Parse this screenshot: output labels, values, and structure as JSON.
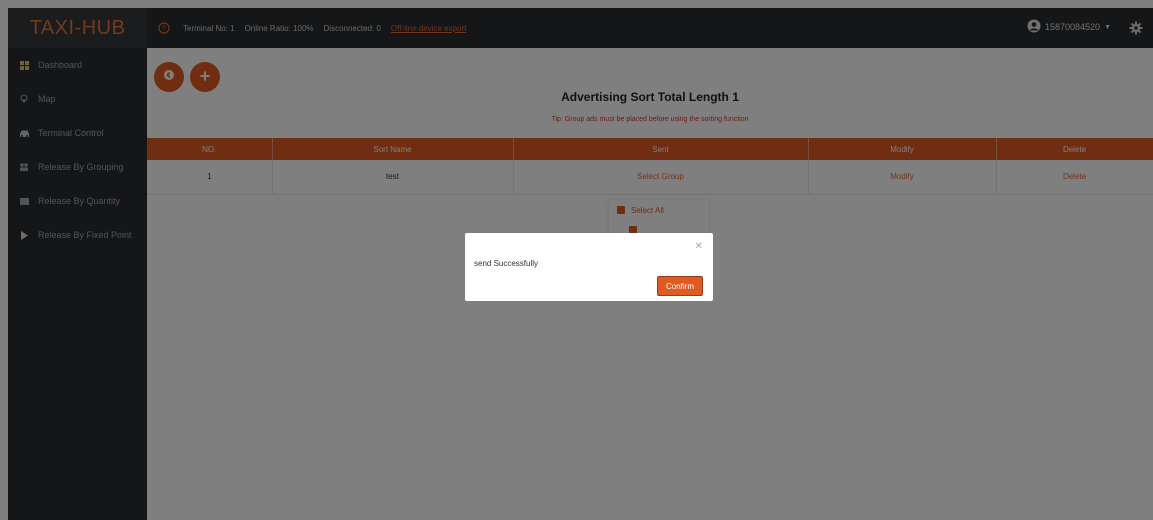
{
  "colors": {
    "accent": "#e05a23",
    "header_bg": "#2a2d30",
    "tip_text": "#e0331c"
  },
  "header": {
    "brand": "TAXI-HUB",
    "stats": {
      "terminal_no": "Terminal No:  1",
      "online_ratio": "Online Ratio:  100%",
      "disconnected": "Disconnected:  0",
      "export_link": "Off-line device export"
    },
    "user": {
      "phone": "15870084520",
      "icon": "user-circle-icon"
    },
    "settings_icon": "gear-icon"
  },
  "sidebar": {
    "items": [
      {
        "label": "Dashboard",
        "icon": "dashboard-icon"
      },
      {
        "label": "Map",
        "icon": "map-pin-icon"
      },
      {
        "label": "Terminal Control",
        "icon": "car-icon"
      },
      {
        "label": "Release By Grouping",
        "icon": "group-icon"
      },
      {
        "label": "Release By Quantity",
        "icon": "list-icon"
      },
      {
        "label": "Release By Fixed Point",
        "icon": "play-icon"
      }
    ]
  },
  "main": {
    "buttons": {
      "back_icon": "back-circle-icon",
      "add_icon": "plus-icon"
    },
    "title": "Advertising Sort Total Length 1",
    "tip": "Tip: Group ads must be placed before using the sorting function",
    "table": {
      "headers": [
        "NO.",
        "Sort Name",
        "Sent",
        "Modify",
        "Delete"
      ],
      "rows": [
        {
          "no": "1",
          "sort_name": "test",
          "sent": "Select Group",
          "modify": "Modify",
          "delete": "Delete"
        }
      ]
    },
    "dropdown": {
      "select_all": "Select All"
    }
  },
  "modal": {
    "message": "send Successfully",
    "confirm_label": "Confirm"
  }
}
